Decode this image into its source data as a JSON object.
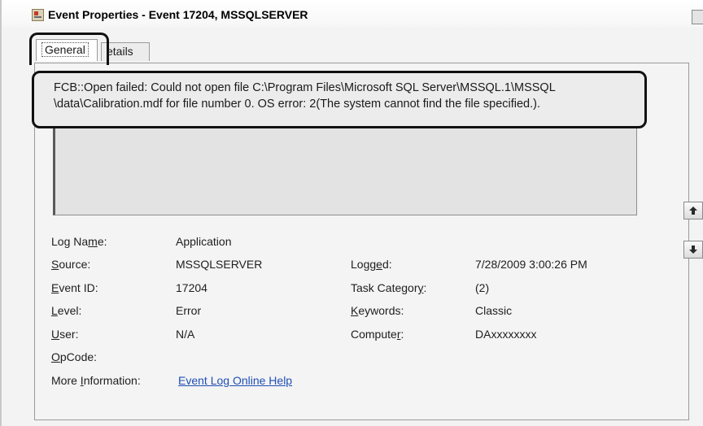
{
  "window": {
    "title": "Event Properties - Event 17204, MSSQLSERVER"
  },
  "tabs": [
    {
      "label": "General"
    },
    {
      "label": "etails"
    }
  ],
  "description": "FCB::Open failed: Could not open file C:\\Program Files\\Microsoft SQL Server\\MSSQL.1\\MSSQL \\data\\Calibration.mdf for file number 0.  OS error: 2(The system cannot find the file specified.).",
  "fields": {
    "log_name": {
      "label_pre": "Log Na",
      "label_ul": "m",
      "label_post": "e:",
      "value": "Application"
    },
    "source": {
      "label_pre": "",
      "label_ul": "S",
      "label_post": "ource:",
      "value": "MSSQLSERVER"
    },
    "event_id": {
      "label_pre": "",
      "label_ul": "E",
      "label_post": "vent ID:",
      "value": "17204"
    },
    "level": {
      "label_pre": "",
      "label_ul": "L",
      "label_post": "evel:",
      "value": "Error"
    },
    "user": {
      "label_pre": "",
      "label_ul": "U",
      "label_post": "ser:",
      "value": "N/A"
    },
    "opcode": {
      "label_pre": "",
      "label_ul": "O",
      "label_post": "pCode:",
      "value": ""
    },
    "more_info": {
      "label_pre": "More ",
      "label_ul": "I",
      "label_post": "nformation:",
      "value": "Event Log Online Help"
    },
    "logged": {
      "label_pre": "Logg",
      "label_ul": "e",
      "label_post": "d:",
      "value": "7/28/2009 3:00:26 PM"
    },
    "task_category": {
      "label_pre": "Task Categor",
      "label_ul": "y",
      "label_post": ":",
      "value": "(2)"
    },
    "keywords": {
      "label_pre": "",
      "label_ul": "K",
      "label_post": "eywords:",
      "value": "Classic"
    },
    "computer": {
      "label_pre": "Compute",
      "label_ul": "r",
      "label_post": ":",
      "value": "DAxxxxxxxx"
    }
  },
  "icons": {
    "title": "event-viewer-icon",
    "up": "arrow-up-icon",
    "down": "arrow-down-icon"
  }
}
